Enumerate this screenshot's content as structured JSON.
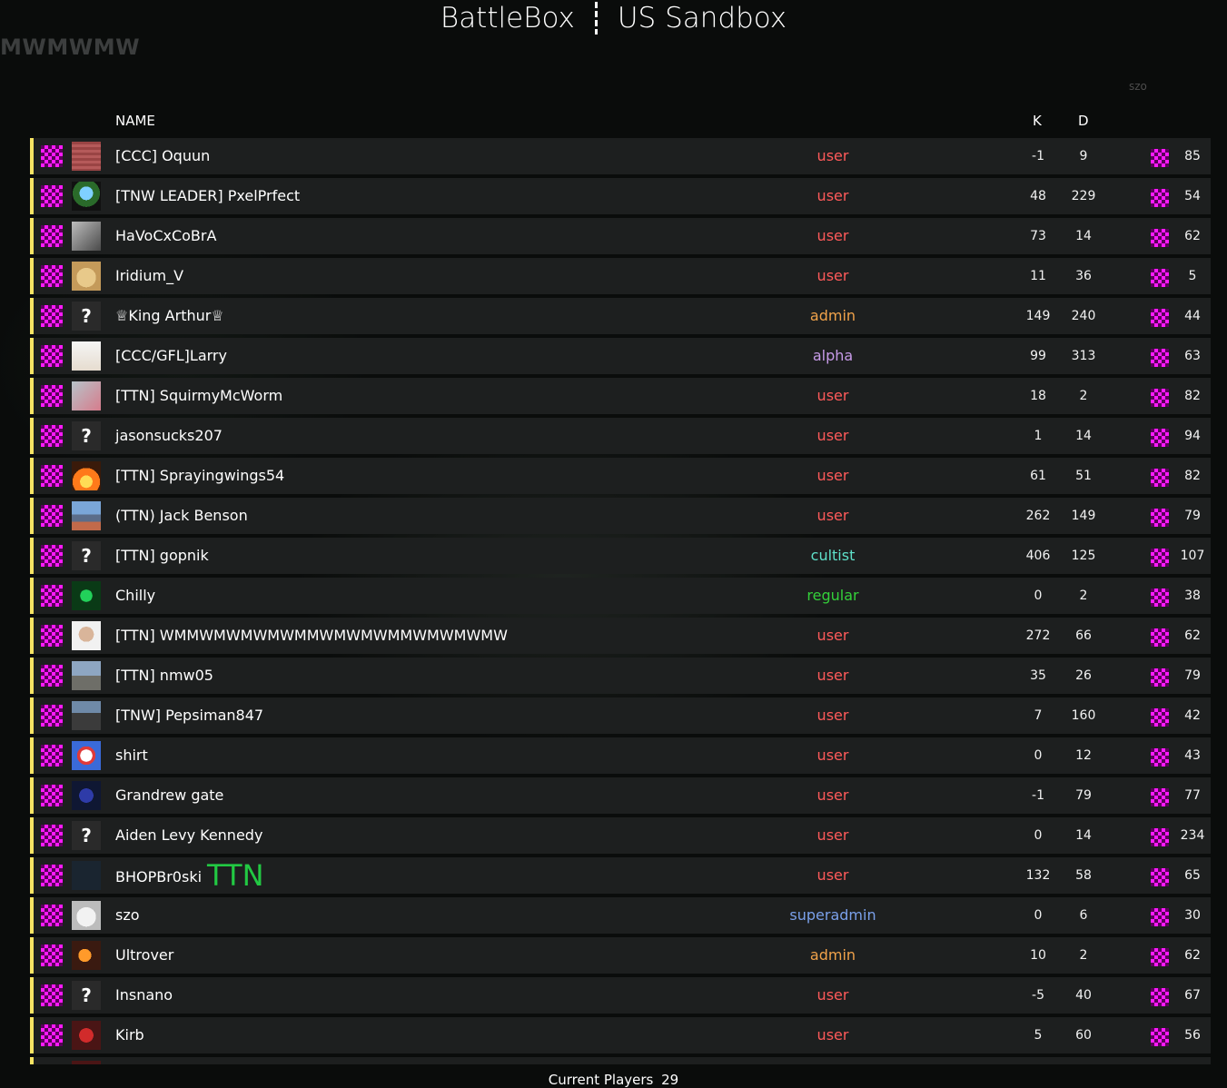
{
  "header": {
    "game_title": "BattleBox",
    "server_title": "US Sandbox"
  },
  "background": {
    "ghost_text": "MWMWMW",
    "ghost_tag": "szo"
  },
  "columns": {
    "name": "NAME",
    "kills": "K",
    "deaths": "D"
  },
  "colors": {
    "row_accent": "#f7e463",
    "user": "#ff5a5a",
    "admin": "#f0a24a",
    "alpha": "#c79be8",
    "cultist": "#5fe0c9",
    "regular": "#34d03a",
    "superadmin": "#7aa0ea",
    "clan_tag_extra": "#22c943"
  },
  "players": [
    {
      "name": "[CCC] Oquun",
      "avatar": "red-stripes",
      "rank": "user",
      "k": "-1",
      "d": "9",
      "ping": "85"
    },
    {
      "name": "[TNW LEADER] PxelPrfect",
      "avatar": "pixel-sprite",
      "rank": "user",
      "k": "48",
      "d": "229",
      "ping": "54"
    },
    {
      "name": "HaVoCxCoBrA",
      "avatar": "raptor",
      "rank": "user",
      "k": "73",
      "d": "14",
      "ping": "62"
    },
    {
      "name": "Iridium_V",
      "avatar": "doge",
      "rank": "user",
      "k": "11",
      "d": "36",
      "ping": "5"
    },
    {
      "name": "♕King Arthur♕",
      "avatar": "unknown",
      "rank": "admin",
      "k": "149",
      "d": "240",
      "ping": "44"
    },
    {
      "name": "[CCC/GFL]Larry",
      "avatar": "skeleton",
      "rank": "alpha",
      "k": "99",
      "d": "313",
      "ping": "63"
    },
    {
      "name": "[TTN] SquirmyMcWorm",
      "avatar": "flamingo",
      "rank": "user",
      "k": "18",
      "d": "2",
      "ping": "82"
    },
    {
      "name": "jasonsucks207",
      "avatar": "unknown",
      "rank": "user",
      "k": "1",
      "d": "14",
      "ping": "94"
    },
    {
      "name": "[TTN] Sprayingwings54",
      "avatar": "fire",
      "rank": "user",
      "k": "61",
      "d": "51",
      "ping": "82"
    },
    {
      "name": "(TTN) Jack Benson",
      "avatar": "mountains",
      "rank": "user",
      "k": "262",
      "d": "149",
      "ping": "79"
    },
    {
      "name": "[TTN] gopnik",
      "avatar": "unknown",
      "rank": "cultist",
      "k": "406",
      "d": "125",
      "ping": "107"
    },
    {
      "name": "Chilly",
      "avatar": "leaf",
      "rank": "regular",
      "k": "0",
      "d": "2",
      "ping": "38"
    },
    {
      "name": "[TTN] WMMWMWMWMWMMWMWMWMMWMWMWMW",
      "avatar": "portrait",
      "rank": "user",
      "k": "272",
      "d": "66",
      "ping": "62"
    },
    {
      "name": "[TTN] nmw05",
      "avatar": "landscape",
      "rank": "user",
      "k": "35",
      "d": "26",
      "ping": "79"
    },
    {
      "name": "[TNW] Pepsiman847",
      "avatar": "person",
      "rank": "user",
      "k": "7",
      "d": "160",
      "ping": "42"
    },
    {
      "name": "shirt",
      "avatar": "logo",
      "rank": "user",
      "k": "0",
      "d": "12",
      "ping": "43"
    },
    {
      "name": "Grandrew gate",
      "avatar": "dark-figure",
      "rank": "user",
      "k": "-1",
      "d": "79",
      "ping": "77"
    },
    {
      "name": "Aiden Levy Kennedy",
      "avatar": "unknown",
      "rank": "user",
      "k": "0",
      "d": "14",
      "ping": "234"
    },
    {
      "name": "BHOPBr0ski",
      "name_extra": "TTN",
      "avatar": "dark",
      "rank": "user",
      "k": "132",
      "d": "58",
      "ping": "65"
    },
    {
      "name": "szo",
      "avatar": "cat",
      "rank": "superadmin",
      "k": "0",
      "d": "6",
      "ping": "30"
    },
    {
      "name": "Ultrover",
      "avatar": "flame-figure",
      "rank": "admin",
      "k": "10",
      "d": "2",
      "ping": "62"
    },
    {
      "name": "Insnano",
      "avatar": "unknown",
      "rank": "user",
      "k": "-5",
      "d": "40",
      "ping": "67"
    },
    {
      "name": "Kirb",
      "avatar": "red-creature",
      "rank": "user",
      "k": "5",
      "d": "60",
      "ping": "56"
    },
    {
      "name": "",
      "avatar": "red-creature",
      "rank": "",
      "k": "",
      "d": "",
      "ping": ""
    }
  ],
  "footer": {
    "label": "Current Players",
    "count": "29"
  },
  "unknown_avatar_glyph": "?"
}
